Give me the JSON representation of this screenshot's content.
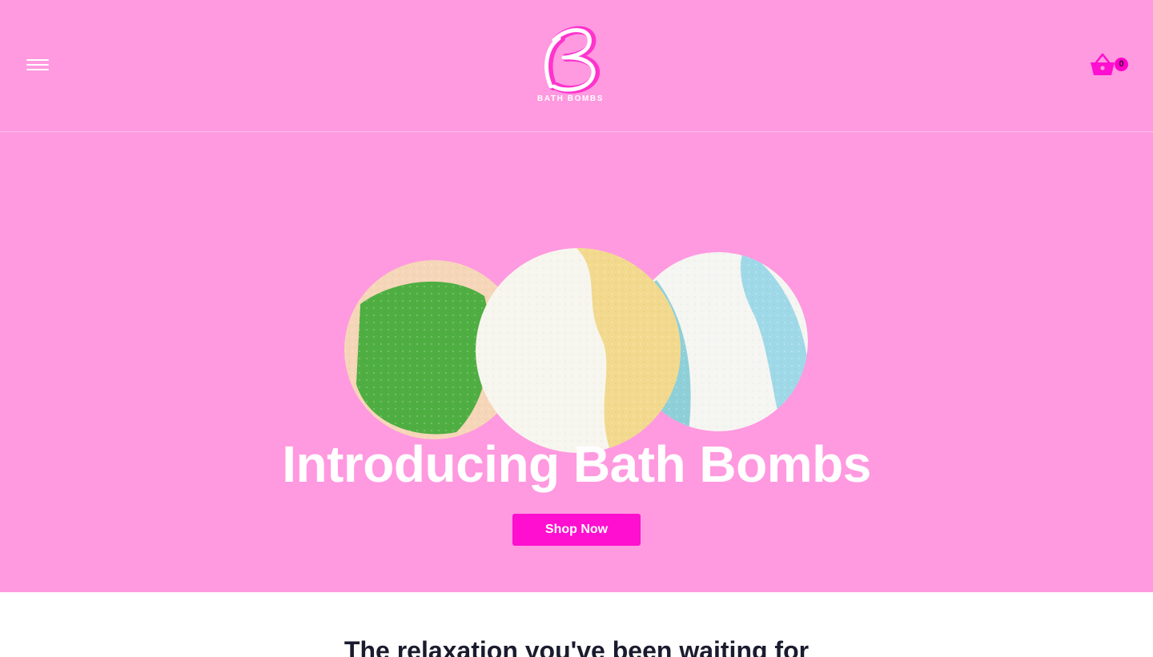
{
  "header": {
    "menu_icon": "hamburger-menu-icon",
    "logo": {
      "monogram": "B",
      "text": "BATH BOMBS"
    },
    "cart": {
      "icon": "shopping-basket-icon",
      "count": "0"
    }
  },
  "hero": {
    "title": "Introducing Bath Bombs",
    "cta_label": "Shop Now"
  },
  "content": {
    "section_title": "The relaxation you've been waiting for"
  },
  "colors": {
    "header_bg": "#ff99e0",
    "hero_bg": "#ff99e0",
    "accent": "#ff0fcf",
    "badge": "#ff00c8",
    "text_dark": "#1b1b2e"
  }
}
